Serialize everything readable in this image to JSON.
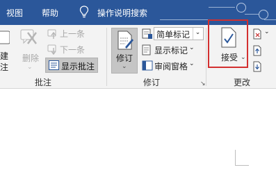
{
  "tabs": {
    "view": "视图",
    "help": "帮助",
    "tell_me": "操作说明搜索"
  },
  "comments_group": {
    "new_partial_1": "建",
    "new_partial_2": "注",
    "delete": "删除",
    "previous": "上一条",
    "next": "下一条",
    "show_comments": "显示批注",
    "label": "批注"
  },
  "tracking_group": {
    "track_changes": "修订",
    "simple_markup": "简单标记",
    "show_markup": "显示标记",
    "reviewing_pane": "审阅窗格",
    "label": "修订"
  },
  "changes_group": {
    "accept": "接受",
    "label": "更改"
  },
  "colors": {
    "title_bar": "#2b579a",
    "ribbon_bg": "#f3f3f3",
    "highlight_box": "#d32f2f",
    "accent_blue": "#2b579a"
  }
}
